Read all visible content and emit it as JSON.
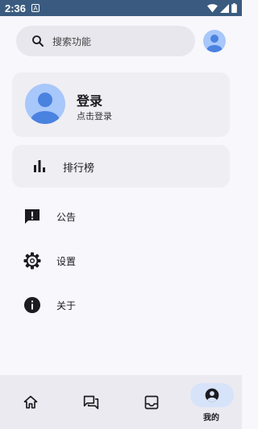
{
  "status_bar": {
    "time": "2:36",
    "notification_icon": "a-square-icon",
    "icons": [
      "wifi-icon",
      "signal-icon",
      "battery-icon"
    ],
    "background": "#3A5B7F"
  },
  "search": {
    "placeholder": "搜索功能"
  },
  "user_card": {
    "title": "登录",
    "subtitle": "点击登录"
  },
  "rank_card": {
    "label": "排行榜",
    "icon": "bar-chart-icon"
  },
  "menu": [
    {
      "label": "公告",
      "icon": "announcement-icon"
    },
    {
      "label": "设置",
      "icon": "gear-icon"
    },
    {
      "label": "关于",
      "icon": "info-icon"
    }
  ],
  "bottom_nav": {
    "items": [
      {
        "icon": "home-icon"
      },
      {
        "icon": "forum-icon"
      },
      {
        "icon": "inbox-icon"
      },
      {
        "icon": "account-icon",
        "label": "我的",
        "active": true
      }
    ],
    "active_color": "#D7E3F8"
  },
  "colors": {
    "avatar_bg": "#A8C7FA",
    "avatar_fg": "#4A82E0"
  }
}
